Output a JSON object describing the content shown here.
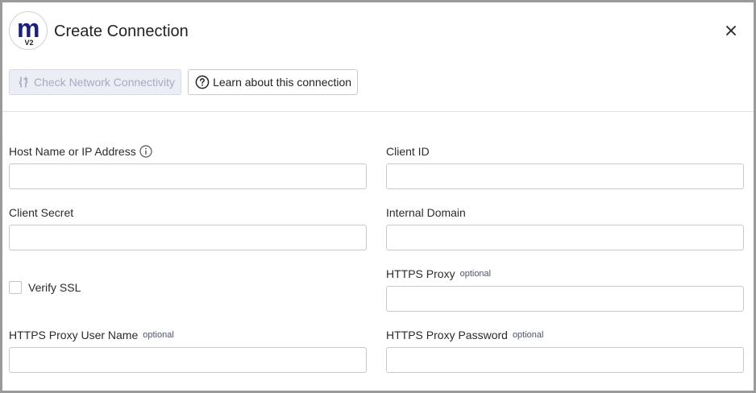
{
  "logo": {
    "mark": "m",
    "version": "V2"
  },
  "header": {
    "title": "Create Connection"
  },
  "toolbar": {
    "check_label": "Check Network Connectivity",
    "learn_label": "Learn about this connection"
  },
  "form": {
    "host": {
      "label": "Host Name or IP Address",
      "value": ""
    },
    "client_id": {
      "label": "Client ID",
      "value": ""
    },
    "client_secret": {
      "label": "Client Secret",
      "value": ""
    },
    "internal_domain": {
      "label": "Internal Domain",
      "value": ""
    },
    "verify_ssl": {
      "label": "Verify SSL",
      "checked": false
    },
    "https_proxy": {
      "label": "HTTPS Proxy",
      "optional": "optional",
      "value": ""
    },
    "proxy_user": {
      "label": "HTTPS Proxy User Name",
      "optional": "optional",
      "value": ""
    },
    "proxy_password": {
      "label": "HTTPS Proxy Password",
      "optional": "optional",
      "value": ""
    }
  },
  "colors": {
    "brand": "#1b1f7a",
    "disabled_text": "#a6abc0",
    "border": "#c9c9c9"
  }
}
